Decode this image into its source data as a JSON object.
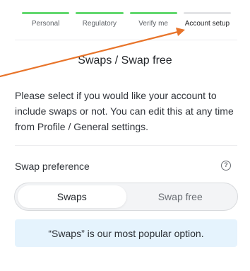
{
  "stepper": {
    "steps": [
      {
        "label": "Personal",
        "state": "done"
      },
      {
        "label": "Regulatory",
        "state": "done"
      },
      {
        "label": "Verify me",
        "state": "done"
      },
      {
        "label": "Account setup",
        "state": "active"
      }
    ],
    "done_color": "#62d86e",
    "pending_color": "#e3e4e6"
  },
  "page": {
    "title": "Swaps / Swap free",
    "description": "Please select if you would like your account to include swaps or not. You can edit this at any time from Profile / General settings."
  },
  "swap_preference": {
    "label": "Swap preference",
    "help_icon": "question-circle-icon",
    "help_glyph": "?",
    "options": [
      "Swaps",
      "Swap free"
    ],
    "selected": "Swaps"
  },
  "notice": {
    "text": "“Swaps” is our most popular option.",
    "background": "#e5f3fd"
  },
  "annotation": {
    "arrow_color": "#e8742a"
  }
}
